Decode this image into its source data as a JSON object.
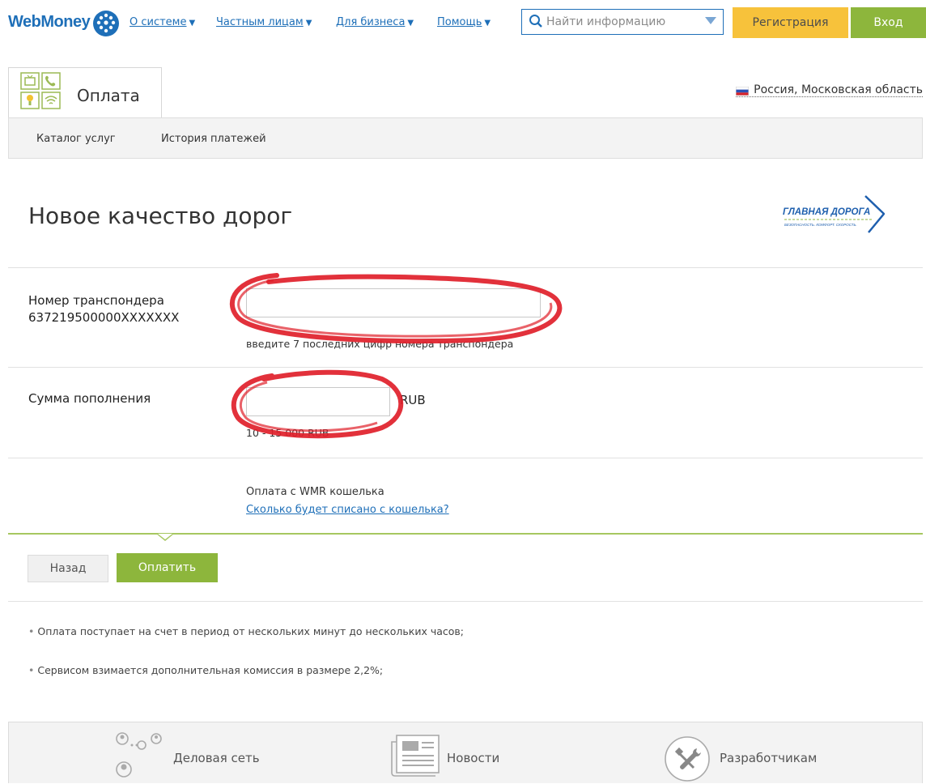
{
  "header": {
    "logo": "WebMoney",
    "nav": [
      {
        "label": "О системе"
      },
      {
        "label": "Частным лицам"
      },
      {
        "label": "Для бизнеса"
      },
      {
        "label": "Помощь"
      }
    ],
    "search_placeholder": "Найти информацию",
    "register_label": "Регистрация",
    "login_label": "Вход"
  },
  "service": {
    "tab_title": "Оплата",
    "region": "Россия, Московская область",
    "subnav": [
      "Каталог услуг",
      "История платежей"
    ]
  },
  "page": {
    "title": "Новое качество дорог",
    "brand_name": "ГЛАВНАЯ ДОРОГА",
    "brand_tagline": "БЕЗОПАСНОСТЬ. КОМФОРТ. СКОРОСТЬ."
  },
  "form": {
    "transponder_label_1": "Номер транспондера",
    "transponder_label_2": "637219500000XXXXXXX",
    "transponder_value": "",
    "transponder_hint": "введите 7 последних цифр номера транспондера",
    "amount_label": "Сумма пополнения",
    "amount_value": "",
    "amount_currency": "RUB",
    "amount_hint": "10 - 15 000 RUB",
    "wallet_text": "Оплата с WMR кошелька",
    "wallet_link": "Сколько будет списано с кошелька?"
  },
  "actions": {
    "back_label": "Назад",
    "pay_label": "Оплатить"
  },
  "notes": [
    "Оплата поступает на счет в период от нескольких минут до нескольких часов;",
    "Сервисом взимается дополнительная комиссия в размере 2,2%;"
  ],
  "footer": {
    "items": [
      "Деловая сеть",
      "Новости",
      "Разработчикам"
    ]
  },
  "colors": {
    "brand_blue": "#1e6fb8",
    "register_yellow": "#f7c23b",
    "action_green": "#8db63c",
    "annotation_red": "#e0202a"
  }
}
